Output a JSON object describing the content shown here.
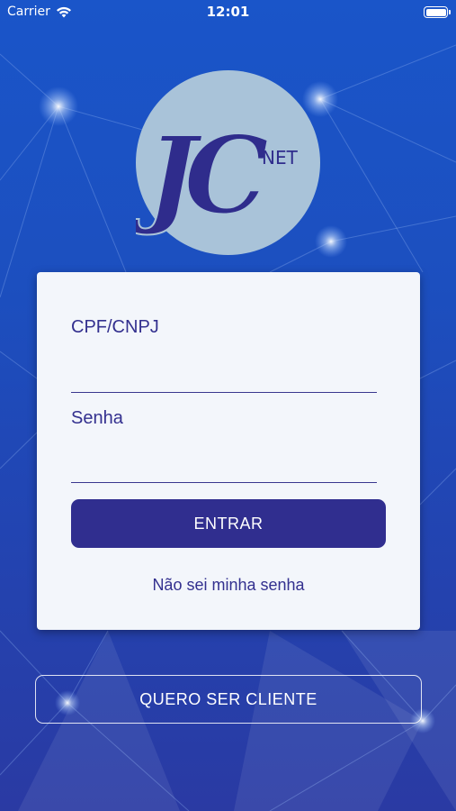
{
  "status_bar": {
    "carrier": "Carrier",
    "time": "12:01",
    "wifi_icon": "wifi-icon",
    "battery_icon": "battery-icon"
  },
  "logo": {
    "letters": "JC",
    "suffix": "NET"
  },
  "login": {
    "cpf_label": "CPF/CNPJ",
    "cpf_value": "",
    "senha_label": "Senha",
    "senha_value": "",
    "submit_label": "ENTRAR",
    "forgot_link": "Não sei minha senha"
  },
  "footer": {
    "signup_label": "QUERO SER CLIENTE"
  },
  "colors": {
    "primary": "#302e8f",
    "background_top": "#1a55c9",
    "background_bottom": "#2a3aa3",
    "card": "#f3f6fb",
    "logo_circle": "#a9c3d9"
  }
}
